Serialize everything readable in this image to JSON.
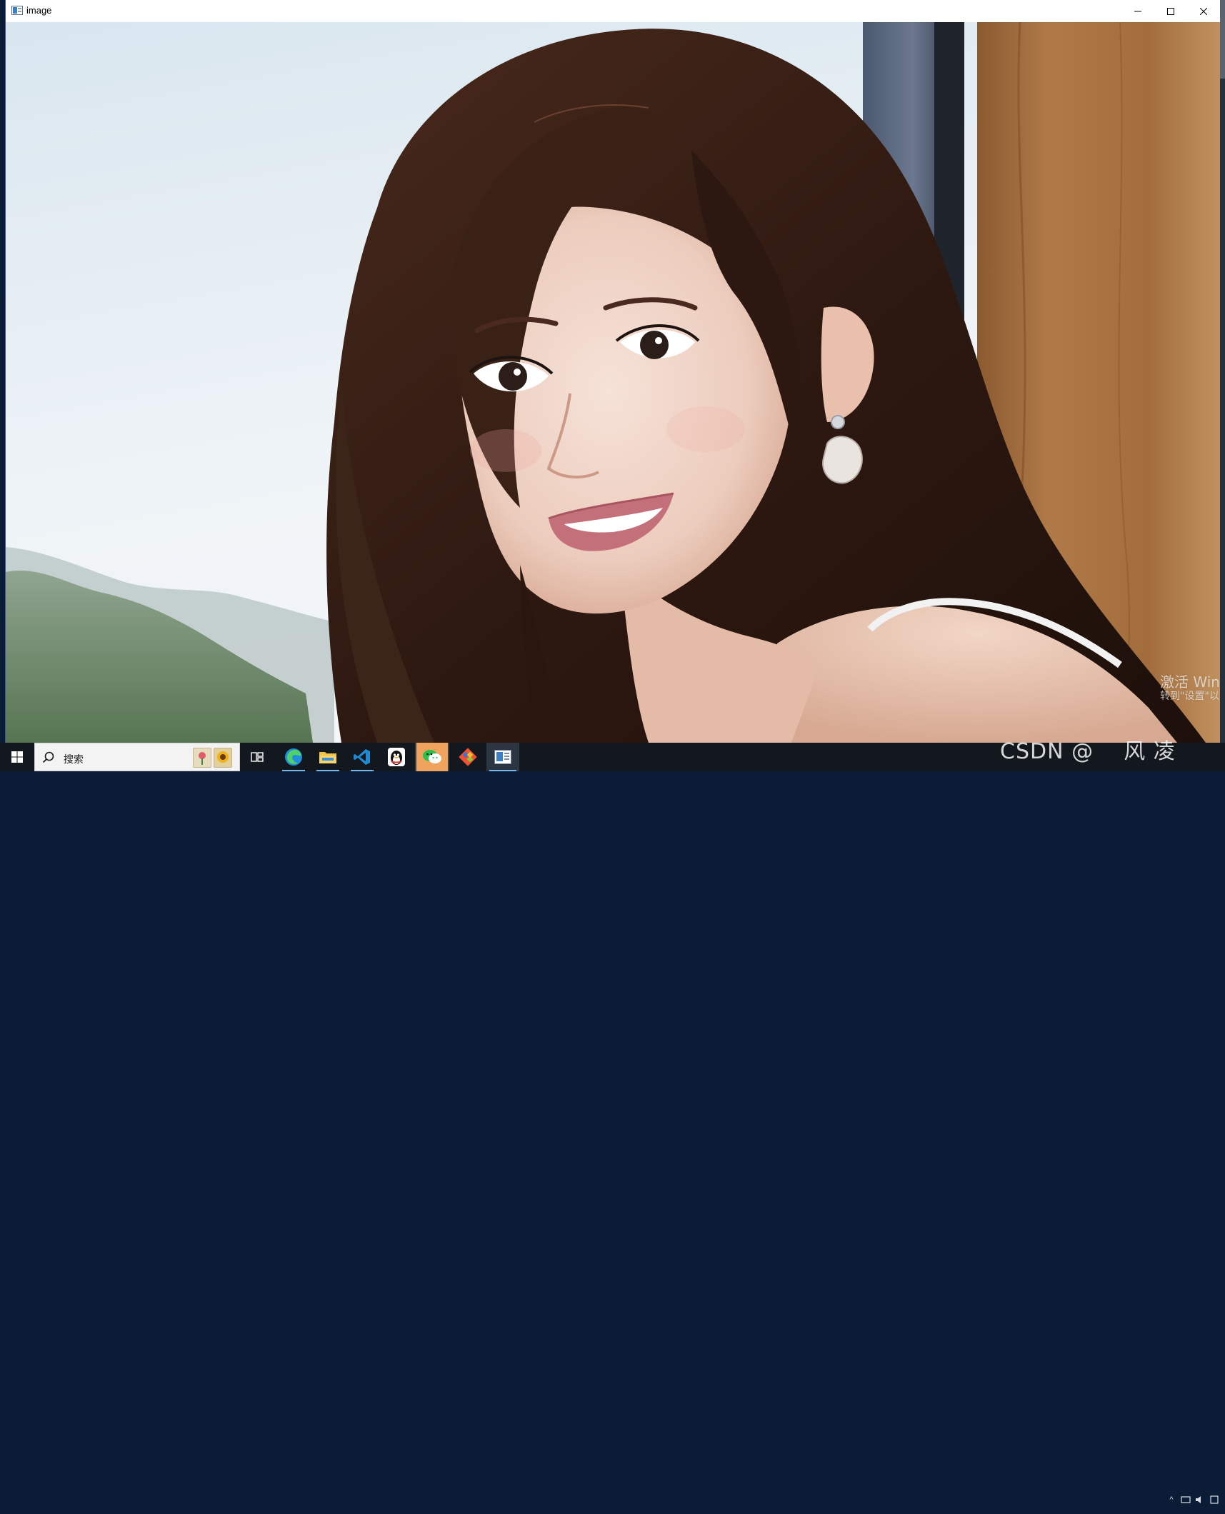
{
  "window": {
    "title": "image",
    "controls": [
      "minimize",
      "maximize",
      "close"
    ]
  },
  "canvas": {
    "description_kind": "photo",
    "watermark": {
      "line1": "激活 Win",
      "line2": "转到\"设置\"以"
    }
  },
  "taskbar": {
    "start_icon": "windows-logo-icon",
    "search": {
      "placeholder": "搜索"
    },
    "apps": [
      {
        "name": "task-view",
        "icon": "task-view-icon"
      },
      {
        "name": "edge",
        "icon": "edge-icon",
        "open": true
      },
      {
        "name": "file-explorer",
        "icon": "folder-icon",
        "open": true
      },
      {
        "name": "vscode",
        "icon": "vscode-icon",
        "open": true
      },
      {
        "name": "qq",
        "icon": "qq-penguin-icon"
      },
      {
        "name": "wechat",
        "icon": "wechat-icon",
        "highlight": true
      },
      {
        "name": "git",
        "icon": "git-icon"
      },
      {
        "name": "image-window",
        "icon": "image-window-icon",
        "active": true
      }
    ],
    "overlay_text": "CSDN @    风 凌"
  },
  "colors": {
    "taskbar_bg": "#13181f",
    "accent": "#76b9ed",
    "wechat_bg": "#f0a35d"
  }
}
